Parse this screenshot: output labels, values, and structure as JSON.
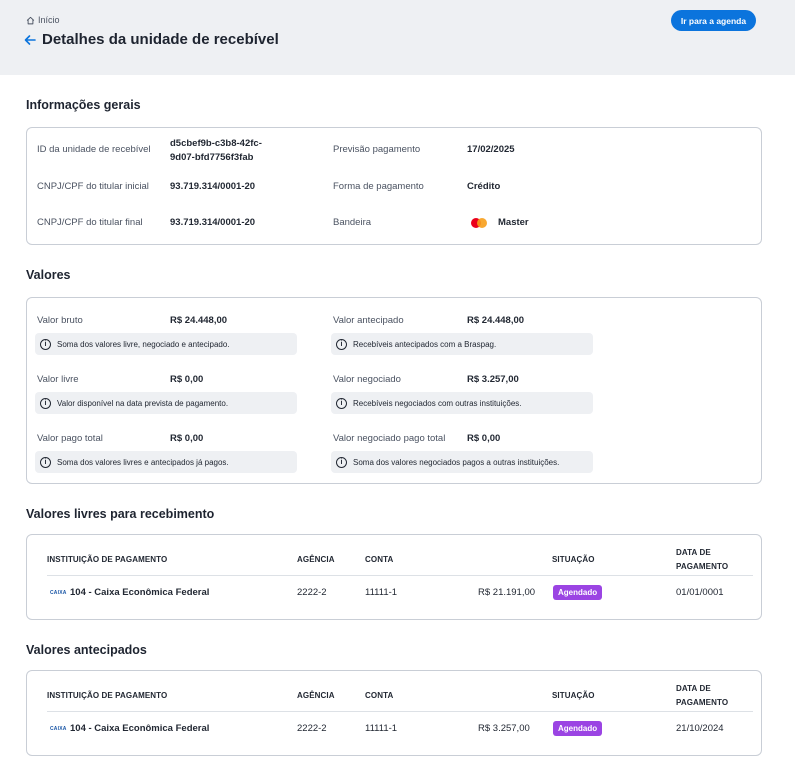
{
  "header": {
    "breadcrumb": "Início",
    "title": "Detalhes da unidade de recebível",
    "agenda_button": "Ir para a agenda"
  },
  "general": {
    "title": "Informações gerais",
    "id_label": "ID da unidade de recebível",
    "id_line1": "d5cbef9b-c3b8-42fc-",
    "id_line2": "9d07-bfd7756f3fab",
    "initial_holder_label": "CNPJ/CPF do titular inicial",
    "initial_holder_value": "93.719.314/0001-20",
    "final_holder_label": "CNPJ/CPF do titular final",
    "final_holder_value": "93.719.314/0001-20",
    "forecast_label": "Previsão pagamento",
    "forecast_value": "17/02/2025",
    "payment_form_label": "Forma de pagamento",
    "payment_form_value": "Crédito",
    "brand_label": "Bandeira",
    "brand_value": "Master",
    "brand_icon": "mastercard-icon"
  },
  "values": {
    "title": "Valores",
    "gross_label": "Valor bruto",
    "gross_value": "R$ 24.448,00",
    "gross_info": "Soma dos valores livre, negociado e antecipado.",
    "anticipated_label": "Valor antecipado",
    "anticipated_value": "R$ 24.448,00",
    "anticipated_info": "Recebíveis antecipados com a Braspag.",
    "free_label": "Valor livre",
    "free_value": "R$ 0,00",
    "free_info": "Valor disponível na data prevista de pagamento.",
    "negotiated_label": "Valor negociado",
    "negotiated_value": "R$ 3.257,00",
    "negotiated_info": "Recebíveis negociados com outras instituições.",
    "paid_total_label": "Valor pago total",
    "paid_total_value": "R$ 0,00",
    "paid_total_info": "Soma dos valores livres e antecipados já pagos.",
    "negotiated_paid_label": "Valor negociado pago total",
    "negotiated_paid_value": "R$ 0,00",
    "negotiated_paid_info": "Soma dos valores negociados pagos a outras instituições."
  },
  "table_headers": {
    "institution": "INSTITUIÇÃO DE PAGAMENTO",
    "agency": "AGÊNCIA",
    "account": "CONTA",
    "status": "SITUAÇÃO",
    "date_line1": "DATA DE",
    "date_line2": "PAGAMENTO"
  },
  "free_receipts": {
    "title": "Valores livres para recebimento",
    "row": {
      "logo": "CAIXA",
      "institution": "104 - Caixa Econômica Federal",
      "agency": "2222-2",
      "account": "11111-1",
      "amount": "R$ 21.191,00",
      "status": "Agendado",
      "date": "01/01/0001"
    }
  },
  "anticipated_receipts": {
    "title": "Valores antecipados",
    "row": {
      "logo": "CAIXA",
      "institution": "104 - Caixa Econômica Federal",
      "agency": "2222-2",
      "account": "11111-1",
      "amount": "R$ 3.257,00",
      "status": "Agendado",
      "date": "21/10/2024"
    }
  },
  "colors": {
    "primary_button": "#0b74dd",
    "status_badge": "#9b44e3",
    "header_background": "#eef0f3"
  }
}
